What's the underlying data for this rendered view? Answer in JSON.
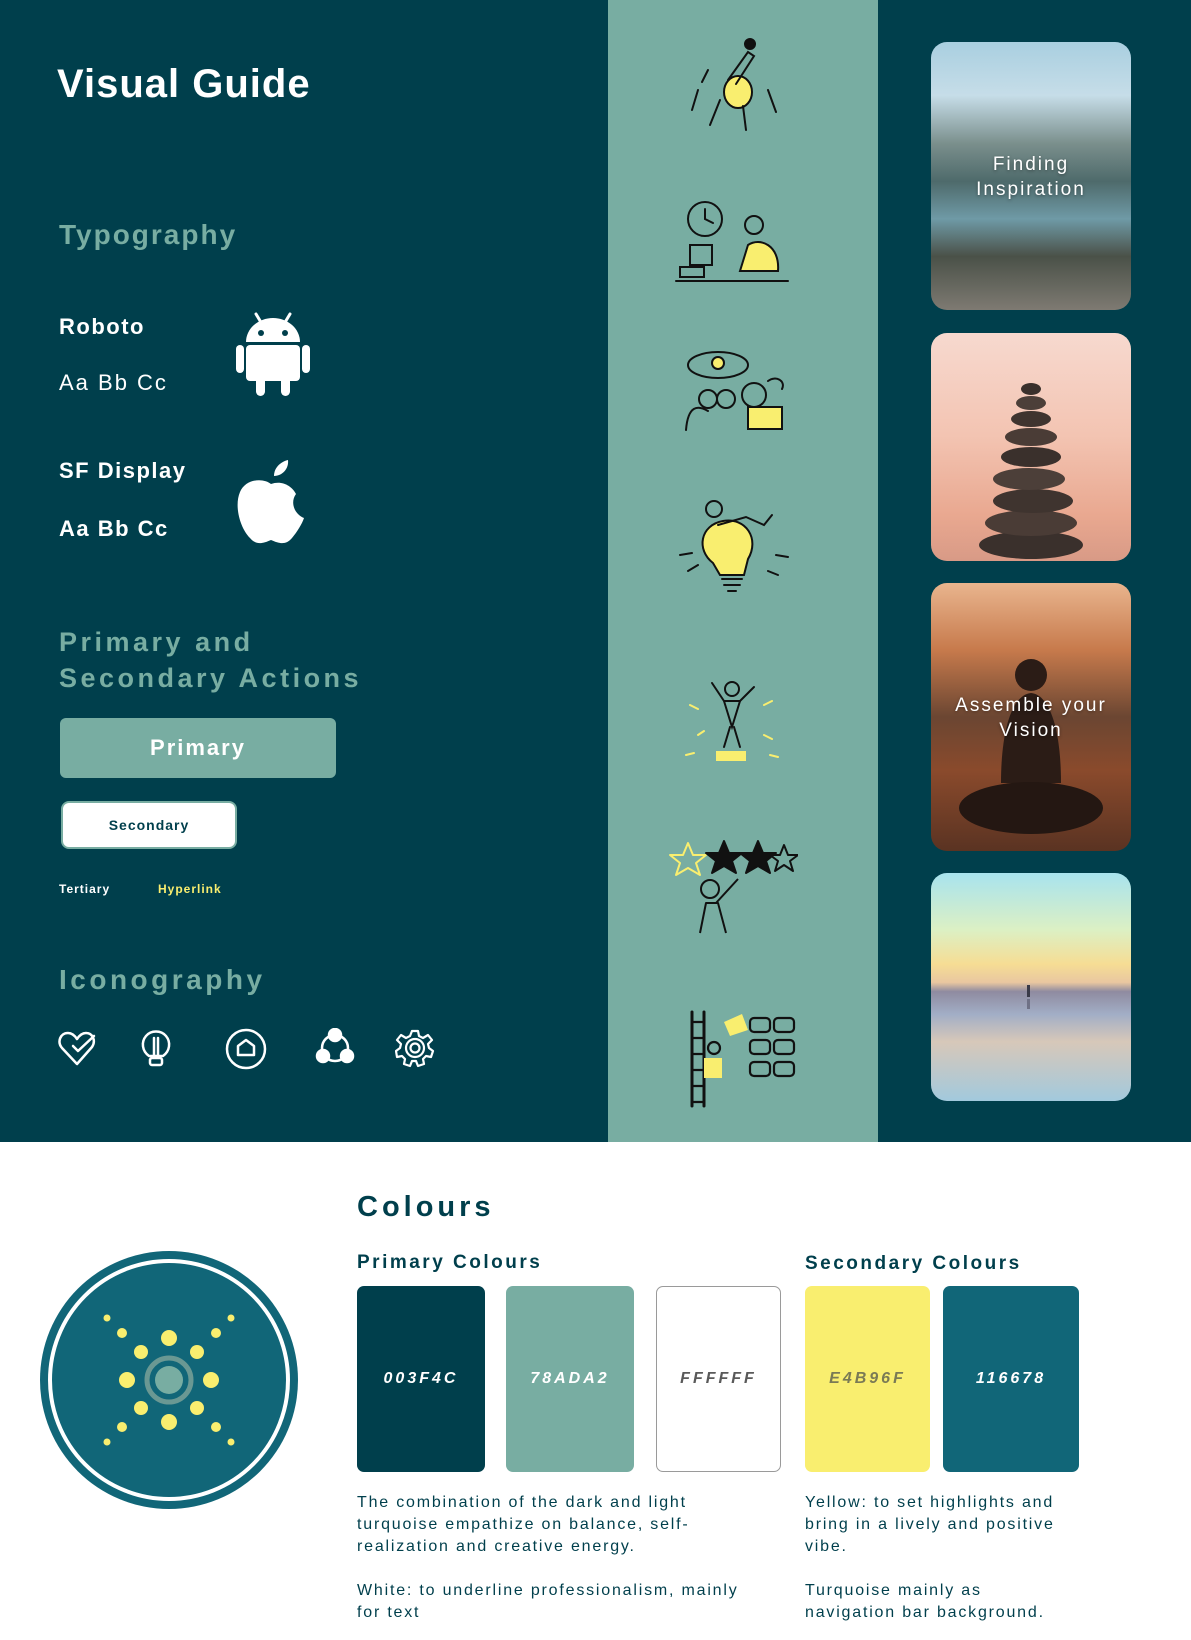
{
  "title": "Visual Guide",
  "typography": {
    "heading": "Typography",
    "fonts": [
      {
        "name": "Roboto",
        "sample": "Aa Bb Cc",
        "icon": "android-icon"
      },
      {
        "name": "SF Display",
        "sample": "Aa Bb Cc",
        "icon": "apple-icon"
      }
    ]
  },
  "actions": {
    "heading_line1": "Primary and",
    "heading_line2": "Secondary Actions",
    "primary_label": "Primary",
    "secondary_label": "Secondary",
    "tertiary_label": "Tertiary",
    "hyperlink_label": "Hyperlink"
  },
  "iconography": {
    "heading": "Iconography",
    "icons": [
      "heart-check-icon",
      "lightbulb-icon",
      "home-circle-icon",
      "community-icon",
      "settings-gear-icon"
    ]
  },
  "illustrations": [
    "flying-person-illustration",
    "desk-work-illustration",
    "binoculars-illustration",
    "lightbulb-person-illustration",
    "celebrating-person-illustration",
    "star-rating-illustration",
    "ladder-grid-illustration"
  ],
  "photos": [
    {
      "caption_line1": "Finding",
      "caption_line2": "Inspiration"
    },
    {
      "caption_line1": "",
      "caption_line2": ""
    },
    {
      "caption_line1": "Assemble your",
      "caption_line2": "Vision"
    },
    {
      "caption_line1": "",
      "caption_line2": ""
    }
  ],
  "logo": {
    "icon": "app-logo-icon"
  },
  "colours": {
    "heading": "Colours",
    "primary_heading": "Primary Colours",
    "secondary_heading": "Secondary Colours",
    "primary": [
      {
        "hex_label": "003F4C",
        "color": "#003F4C",
        "text_color": "#FFFFFF"
      },
      {
        "hex_label": "78ADA2",
        "color": "#78ADA2",
        "text_color": "#FFFFFF"
      },
      {
        "hex_label": "FFFFFF",
        "color": "#FFFFFF",
        "text_color": "#5A5A5A"
      }
    ],
    "secondary": [
      {
        "hex_label": "E4B96F",
        "color": "#F9EE6F",
        "text_color": "#7A7A55"
      },
      {
        "hex_label": "116678",
        "color": "#116678",
        "text_color": "#FFFFFF"
      }
    ],
    "primary_desc1_line1": "The combination of the dark and light",
    "primary_desc1_line2": "turquoise empathize on balance, self-",
    "primary_desc1_line3": "realization and creative energy.",
    "primary_desc2_line1": "White: to underline professionalism, mainly",
    "primary_desc2_line2": "for text",
    "secondary_desc1_line1": "Yellow: to set highlights and",
    "secondary_desc1_line2": "bring in a lively and positive",
    "secondary_desc1_line3": "vibe.",
    "secondary_desc2_line1": "Turquoise mainly as",
    "secondary_desc2_line2": "navigation bar background."
  }
}
